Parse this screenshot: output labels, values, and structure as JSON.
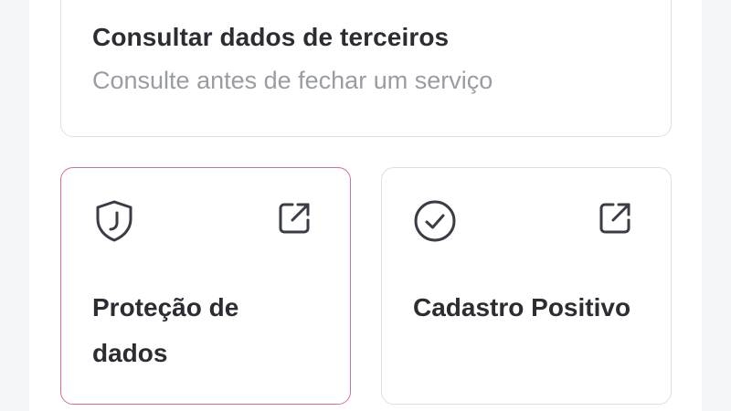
{
  "query_card": {
    "title": "Consultar dados de terceiros",
    "subtitle": "Consulte antes de fechar um serviço"
  },
  "shortcuts": [
    {
      "label": "Proteção de dados",
      "icon": "shield-icon",
      "action_icon": "external-link-icon",
      "highlighted": true,
      "border_color": "#d66aa0"
    },
    {
      "label": "Cadastro Positivo",
      "icon": "check-circle-icon",
      "action_icon": "external-link-icon",
      "highlighted": false,
      "border_color": "#dedfe3"
    }
  ],
  "colors": {
    "text_primary": "#2b2d33",
    "text_secondary": "#9a9ca3",
    "icon": "#3a3d45",
    "accent": "#d66aa0"
  }
}
